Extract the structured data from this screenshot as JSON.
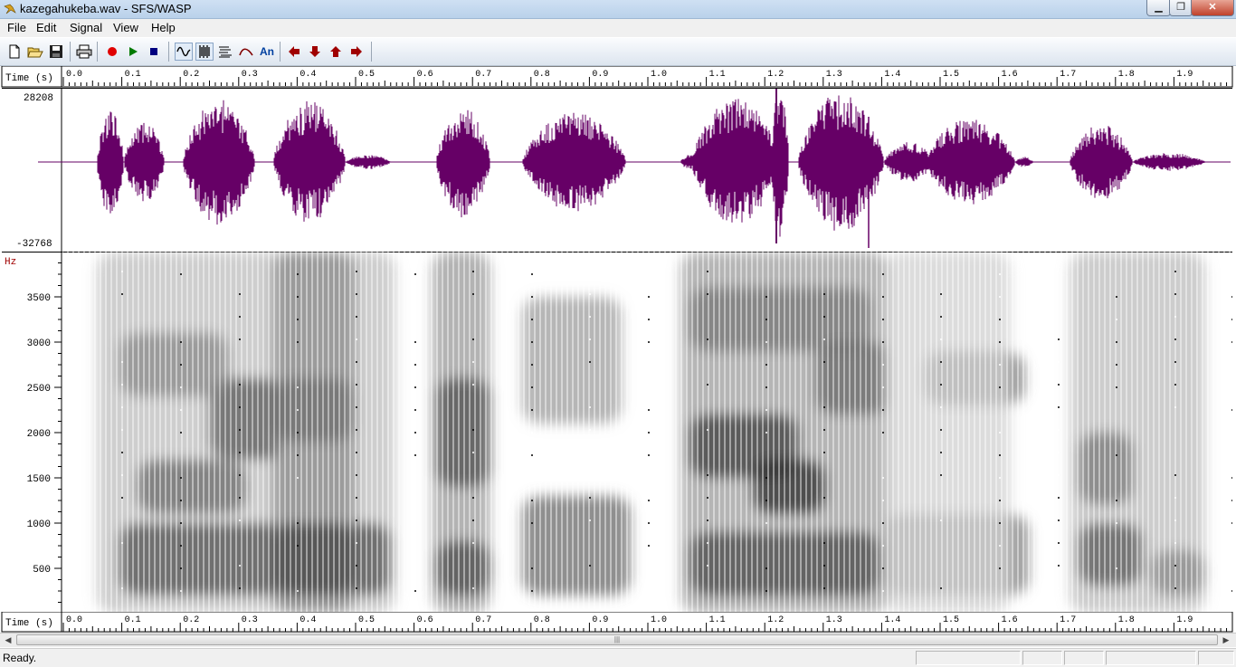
{
  "window": {
    "title": "kazegahukeba.wav - SFS/WASP",
    "min_symbol": "▁",
    "max_symbol": "❐",
    "close_symbol": "✕"
  },
  "menu": {
    "items": [
      "File",
      "Edit",
      "Signal",
      "View",
      "Help"
    ]
  },
  "toolbar": {
    "buttons": [
      {
        "icon": "new-file-icon"
      },
      {
        "icon": "open-folder-icon"
      },
      {
        "icon": "save-icon"
      },
      {
        "icon": "print-icon"
      },
      {
        "icon": "record-icon"
      },
      {
        "icon": "play-icon"
      },
      {
        "icon": "stop-icon"
      },
      {
        "icon": "waveform-view-icon"
      },
      {
        "icon": "spectrogram-view-icon"
      },
      {
        "icon": "spectrum-view-icon"
      },
      {
        "icon": "pitch-view-icon"
      },
      {
        "icon": "annotation-icon",
        "label": "An"
      },
      {
        "icon": "arrow-left-icon"
      },
      {
        "icon": "arrow-down-icon"
      },
      {
        "icon": "arrow-up-icon"
      },
      {
        "icon": "arrow-right-icon"
      }
    ],
    "colors": {
      "record": "#e00000",
      "play": "#007a00",
      "stop": "#000080",
      "arrows": "#a00000",
      "an": "#0040a0"
    }
  },
  "time_axis": {
    "label": "Time (s)",
    "ticks": [
      "0.0",
      "0.1",
      "0.2",
      "0.3",
      "0.4",
      "0.5",
      "0.6",
      "0.7",
      "0.8",
      "0.9",
      "1.0",
      "1.1",
      "1.2",
      "1.3",
      "1.4",
      "1.5",
      "1.6",
      "1.7",
      "1.8",
      "1.9"
    ],
    "max_seconds": 2.0
  },
  "waveform": {
    "max_label": "28208",
    "min_label": "-32768",
    "color": "#660066"
  },
  "spectrogram": {
    "unit_label": "Hz",
    "freq_ticks": [
      "3500",
      "3000",
      "2500",
      "2000",
      "1500",
      "1000",
      "500"
    ],
    "unit_color": "#a00000"
  },
  "statusbar": {
    "text": "Ready."
  },
  "scrollbar": {
    "left_arrow": "◀",
    "right_arrow": "▶",
    "grip": "|||"
  }
}
